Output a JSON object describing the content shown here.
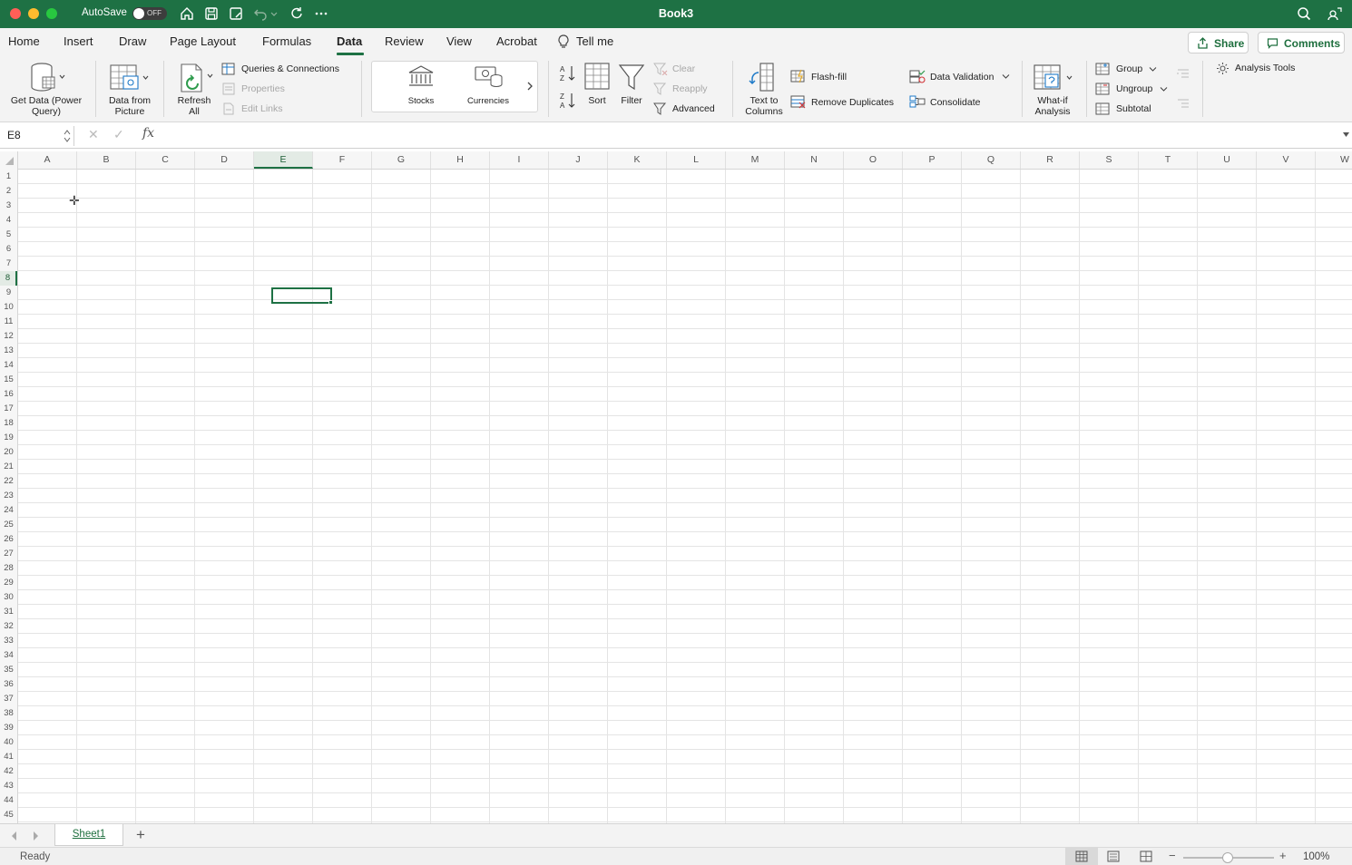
{
  "titlebar": {
    "autosave_label": "AutoSave",
    "autosave_state": "OFF",
    "doc_title": "Book3",
    "accent_color": "#1e7144"
  },
  "tabs": {
    "home": "Home",
    "insert": "Insert",
    "draw": "Draw",
    "page_layout": "Page Layout",
    "formulas": "Formulas",
    "data": "Data",
    "review": "Review",
    "view": "View",
    "acrobat": "Acrobat",
    "tell_me": "Tell me",
    "active": "Data"
  },
  "top_buttons": {
    "share": "Share",
    "comments": "Comments"
  },
  "ribbon": {
    "get_data": "Get Data (Power Query)",
    "data_from_picture": "Data from Picture",
    "refresh_all": "Refresh All",
    "queries_connections": "Queries & Connections",
    "properties": "Properties",
    "edit_links": "Edit Links",
    "stocks": "Stocks",
    "currencies": "Currencies",
    "sort": "Sort",
    "filter": "Filter",
    "clear": "Clear",
    "reapply": "Reapply",
    "advanced": "Advanced",
    "text_to_columns": "Text to Columns",
    "flash_fill": "Flash-fill",
    "remove_duplicates": "Remove Duplicates",
    "data_validation": "Data Validation",
    "consolidate": "Consolidate",
    "what_if": "What-if Analysis",
    "group": "Group",
    "ungroup": "Ungroup",
    "subtotal": "Subtotal",
    "analysis_tools": "Analysis Tools"
  },
  "formula_bar": {
    "name_box": "E8",
    "fx": "fx",
    "value": ""
  },
  "grid": {
    "columns": [
      "A",
      "B",
      "C",
      "D",
      "E",
      "F",
      "G",
      "H",
      "I",
      "J",
      "K",
      "L",
      "M",
      "N",
      "O",
      "P",
      "Q",
      "R",
      "S",
      "T",
      "U",
      "V",
      "W"
    ],
    "rows": [
      "1",
      "2",
      "3",
      "4",
      "5",
      "6",
      "7",
      "8",
      "9",
      "10",
      "11",
      "12",
      "13",
      "14",
      "15",
      "16",
      "17",
      "18",
      "19",
      "20",
      "21",
      "22",
      "23",
      "24",
      "25",
      "26",
      "27",
      "28",
      "29",
      "30",
      "31",
      "32",
      "33",
      "34",
      "35",
      "36",
      "37",
      "38",
      "39",
      "40",
      "41",
      "42",
      "43",
      "44",
      "45"
    ],
    "selected_column": "E",
    "selected_row": "8"
  },
  "sheets": {
    "tab": "Sheet1",
    "add": "+"
  },
  "status": {
    "ready": "Ready",
    "zoom": "100%"
  }
}
